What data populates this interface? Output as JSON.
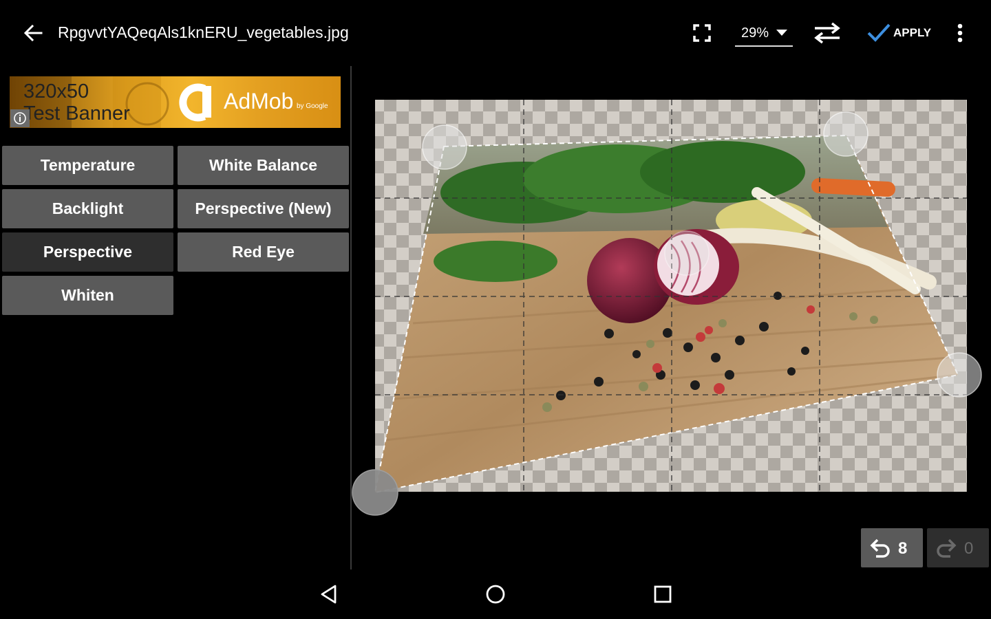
{
  "topbar": {
    "back_icon": "arrow-back-icon",
    "filename": "RpgvvtYAQeqAls1knERU_vegetables.jpg",
    "fullscreen_icon": "fullscreen-icon",
    "zoom": "29%",
    "swap_icon": "swap-icon",
    "apply_label": "APPLY",
    "apply_color": "#3d8fe0",
    "more_icon": "more-vert-icon"
  },
  "ad": {
    "size_text": "320x50",
    "banner_text": "Test Banner",
    "brand": "AdMob",
    "byline": "by Google"
  },
  "tools": [
    {
      "label": "Temperature",
      "selected": false
    },
    {
      "label": "White Balance",
      "selected": false
    },
    {
      "label": "Backlight",
      "selected": false
    },
    {
      "label": "Perspective (New)",
      "selected": false
    },
    {
      "label": "Perspective",
      "selected": true
    },
    {
      "label": "Red Eye",
      "selected": false
    },
    {
      "label": "Whiten",
      "selected": false
    }
  ],
  "history": {
    "undo_count": "8",
    "redo_count": "0"
  },
  "nav": {
    "back_icon": "nav-back-icon",
    "home_icon": "nav-home-icon",
    "recents_icon": "nav-recents-icon"
  }
}
